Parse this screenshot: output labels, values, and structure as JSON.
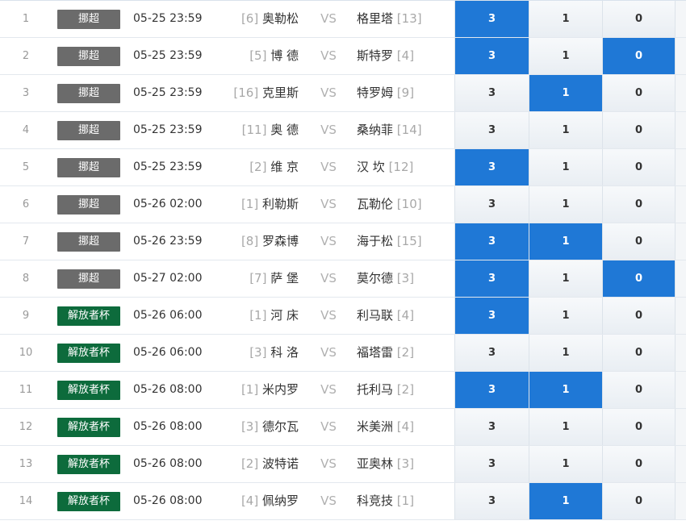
{
  "vs_label": "VS",
  "colors": {
    "league_gray": "#6b6b6b",
    "league_green": "#0d6b3c",
    "selected": "#1f78d6"
  },
  "rows": [
    {
      "idx": "1",
      "league": "挪超",
      "league_color": "#6b6b6b",
      "time": "05-25 23:59",
      "home_rank": "[6]",
      "home": "奥勒松",
      "away": "格里塔",
      "away_rank": "[13]",
      "odds": [
        {
          "v": "3",
          "sel": true
        },
        {
          "v": "1",
          "sel": false
        },
        {
          "v": "0",
          "sel": false
        }
      ]
    },
    {
      "idx": "2",
      "league": "挪超",
      "league_color": "#6b6b6b",
      "time": "05-25 23:59",
      "home_rank": "[5]",
      "home": "博 德",
      "away": "斯特罗",
      "away_rank": "[4]",
      "odds": [
        {
          "v": "3",
          "sel": true
        },
        {
          "v": "1",
          "sel": false
        },
        {
          "v": "0",
          "sel": true
        }
      ]
    },
    {
      "idx": "3",
      "league": "挪超",
      "league_color": "#6b6b6b",
      "time": "05-25 23:59",
      "home_rank": "[16]",
      "home": "克里斯",
      "away": "特罗姆",
      "away_rank": "[9]",
      "odds": [
        {
          "v": "3",
          "sel": false
        },
        {
          "v": "1",
          "sel": true
        },
        {
          "v": "0",
          "sel": false
        }
      ]
    },
    {
      "idx": "4",
      "league": "挪超",
      "league_color": "#6b6b6b",
      "time": "05-25 23:59",
      "home_rank": "[11]",
      "home": "奥 德",
      "away": "桑纳菲",
      "away_rank": "[14]",
      "odds": [
        {
          "v": "3",
          "sel": false
        },
        {
          "v": "1",
          "sel": false
        },
        {
          "v": "0",
          "sel": false
        }
      ]
    },
    {
      "idx": "5",
      "league": "挪超",
      "league_color": "#6b6b6b",
      "time": "05-25 23:59",
      "home_rank": "[2]",
      "home": "维 京",
      "away": "汉 坎",
      "away_rank": "[12]",
      "odds": [
        {
          "v": "3",
          "sel": true
        },
        {
          "v": "1",
          "sel": false
        },
        {
          "v": "0",
          "sel": false
        }
      ]
    },
    {
      "idx": "6",
      "league": "挪超",
      "league_color": "#6b6b6b",
      "time": "05-26 02:00",
      "home_rank": "[1]",
      "home": "利勒斯",
      "away": "瓦勒伦",
      "away_rank": "[10]",
      "odds": [
        {
          "v": "3",
          "sel": false
        },
        {
          "v": "1",
          "sel": false
        },
        {
          "v": "0",
          "sel": false
        }
      ]
    },
    {
      "idx": "7",
      "league": "挪超",
      "league_color": "#6b6b6b",
      "time": "05-26 23:59",
      "home_rank": "[8]",
      "home": "罗森博",
      "away": "海于松",
      "away_rank": "[15]",
      "odds": [
        {
          "v": "3",
          "sel": true
        },
        {
          "v": "1",
          "sel": true
        },
        {
          "v": "0",
          "sel": false
        }
      ]
    },
    {
      "idx": "8",
      "league": "挪超",
      "league_color": "#6b6b6b",
      "time": "05-27 02:00",
      "home_rank": "[7]",
      "home": "萨 堡",
      "away": "莫尔德",
      "away_rank": "[3]",
      "odds": [
        {
          "v": "3",
          "sel": true
        },
        {
          "v": "1",
          "sel": false
        },
        {
          "v": "0",
          "sel": true
        }
      ]
    },
    {
      "idx": "9",
      "league": "解放者杯",
      "league_color": "#0d6b3c",
      "time": "05-26 06:00",
      "home_rank": "[1]",
      "home": "河 床",
      "away": "利马联",
      "away_rank": "[4]",
      "odds": [
        {
          "v": "3",
          "sel": true
        },
        {
          "v": "1",
          "sel": false
        },
        {
          "v": "0",
          "sel": false
        }
      ]
    },
    {
      "idx": "10",
      "league": "解放者杯",
      "league_color": "#0d6b3c",
      "time": "05-26 06:00",
      "home_rank": "[3]",
      "home": "科 洛",
      "away": "福塔雷",
      "away_rank": "[2]",
      "odds": [
        {
          "v": "3",
          "sel": false
        },
        {
          "v": "1",
          "sel": false
        },
        {
          "v": "0",
          "sel": false
        }
      ]
    },
    {
      "idx": "11",
      "league": "解放者杯",
      "league_color": "#0d6b3c",
      "time": "05-26 08:00",
      "home_rank": "[1]",
      "home": "米内罗",
      "away": "托利马",
      "away_rank": "[2]",
      "odds": [
        {
          "v": "3",
          "sel": true
        },
        {
          "v": "1",
          "sel": true
        },
        {
          "v": "0",
          "sel": false
        }
      ]
    },
    {
      "idx": "12",
      "league": "解放者杯",
      "league_color": "#0d6b3c",
      "time": "05-26 08:00",
      "home_rank": "[3]",
      "home": "德尔瓦",
      "away": "米美洲",
      "away_rank": "[4]",
      "odds": [
        {
          "v": "3",
          "sel": false
        },
        {
          "v": "1",
          "sel": false
        },
        {
          "v": "0",
          "sel": false
        }
      ]
    },
    {
      "idx": "13",
      "league": "解放者杯",
      "league_color": "#0d6b3c",
      "time": "05-26 08:00",
      "home_rank": "[2]",
      "home": "波特诺",
      "away": "亚奥林",
      "away_rank": "[3]",
      "odds": [
        {
          "v": "3",
          "sel": false
        },
        {
          "v": "1",
          "sel": false
        },
        {
          "v": "0",
          "sel": false
        }
      ]
    },
    {
      "idx": "14",
      "league": "解放者杯",
      "league_color": "#0d6b3c",
      "time": "05-26 08:00",
      "home_rank": "[4]",
      "home": "佩纳罗",
      "away": "科竞技",
      "away_rank": "[1]",
      "odds": [
        {
          "v": "3",
          "sel": false
        },
        {
          "v": "1",
          "sel": true
        },
        {
          "v": "0",
          "sel": false
        }
      ]
    }
  ]
}
